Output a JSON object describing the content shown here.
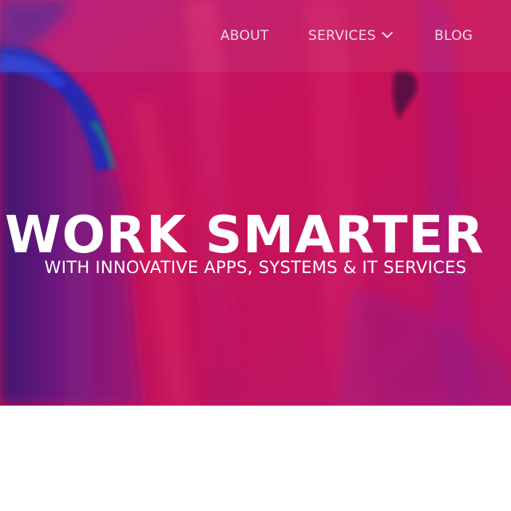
{
  "nav": {
    "items": [
      {
        "label": "ABOUT"
      },
      {
        "label": "SERVICES",
        "icon": "chevron-down-icon"
      },
      {
        "label": "BLOG"
      }
    ]
  },
  "hero": {
    "headline": "WORK SMARTER",
    "tagline": "WITH INNOVATIVE APPS, SYSTEMS & IT SERVICES",
    "background_colors": {
      "base": "#c4104f",
      "magenta": "#b31a86",
      "purple": "#4a1a7a",
      "blue": "#1f2ab8",
      "pink": "#e0246a"
    }
  }
}
